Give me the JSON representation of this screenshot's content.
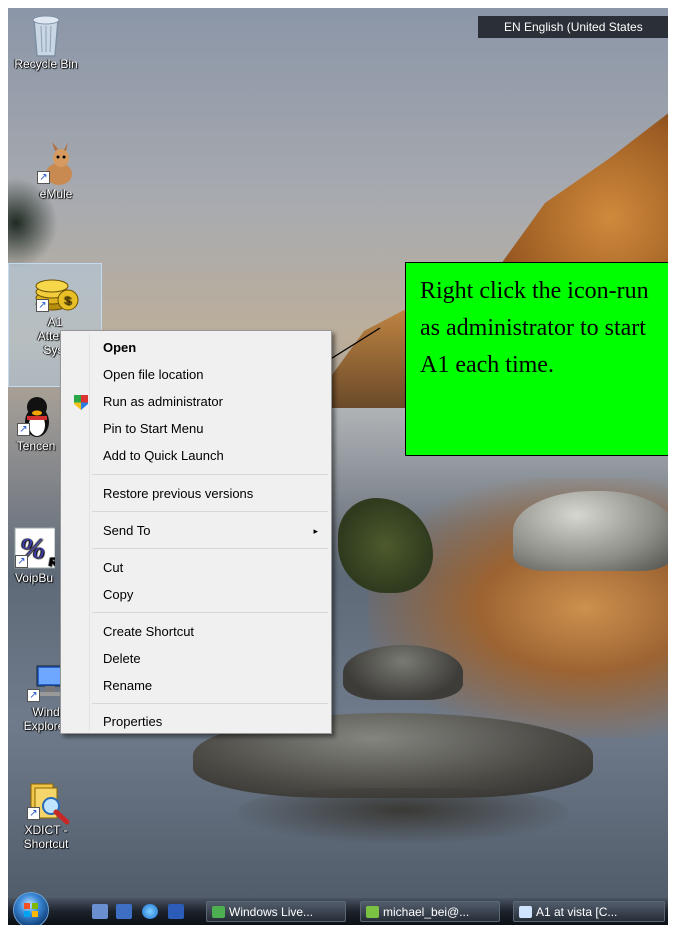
{
  "language_bar": {
    "text": "EN English (United States"
  },
  "desktop_icons": [
    {
      "label": "Recycle Bin"
    },
    {
      "label": "eMule"
    },
    {
      "label_line1": "A1",
      "label_line2": "Attend",
      "label_line3": "Syst"
    },
    {
      "label": "Tencen"
    },
    {
      "label": "VoipBu"
    },
    {
      "label_line1": "Wind",
      "label_line2": "Explorer"
    },
    {
      "label_line1": "XDICT -",
      "label_line2": "Shortcut"
    }
  ],
  "context_menu": {
    "items": [
      {
        "label": "Open"
      },
      {
        "label": "Open file location"
      },
      {
        "label": "Run as administrator"
      },
      {
        "label": "Pin to Start Menu"
      },
      {
        "label": "Add to Quick Launch"
      },
      {
        "label": "Restore previous versions"
      },
      {
        "label": "Send To"
      },
      {
        "label": "Cut"
      },
      {
        "label": "Copy"
      },
      {
        "label": "Create Shortcut"
      },
      {
        "label": "Delete"
      },
      {
        "label": "Rename"
      },
      {
        "label": "Properties"
      }
    ],
    "submenu_arrow": "▸"
  },
  "callout": {
    "text": "Right click the icon-run as administrator to start A1 each time."
  },
  "taskbar": {
    "buttons": [
      {
        "label": "Windows Live..."
      },
      {
        "label": "michael_bei@..."
      },
      {
        "label": "A1 at vista [C..."
      }
    ]
  },
  "colors": {
    "callout_bg": "#00ff00",
    "taskbar": "#1c222b",
    "menu_bg": "#f0f0f0"
  }
}
